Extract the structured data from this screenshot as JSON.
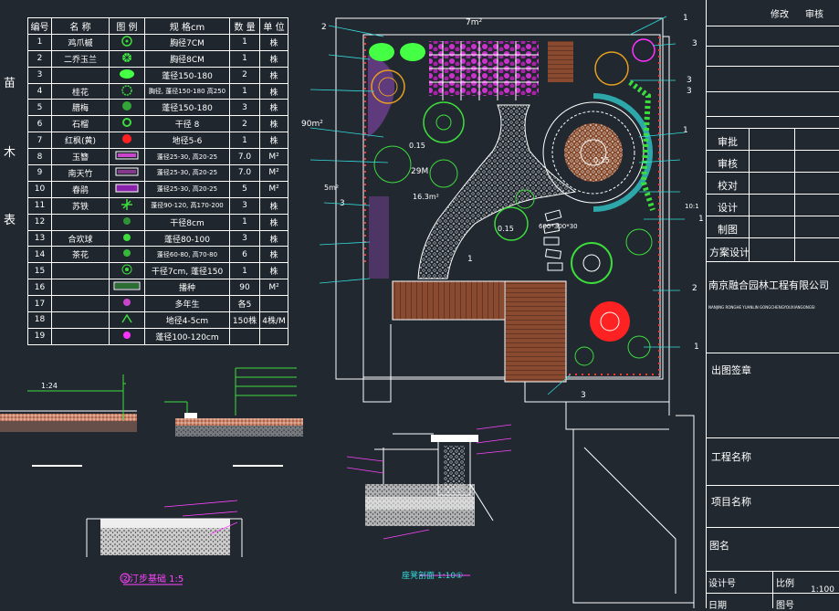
{
  "plant_table": {
    "headers": [
      "编号",
      "名  称",
      "图  例",
      "规  格cm",
      "数 量",
      "单 位"
    ],
    "rows": [
      {
        "no": "1",
        "name": "鸡爪槭",
        "spec": "胸径7CM",
        "qty": "1",
        "unit": "株",
        "icon": "maple",
        "color": "#3ddc3d"
      },
      {
        "no": "2",
        "name": "二乔玉兰",
        "spec": "胸径8CM",
        "qty": "1",
        "unit": "株",
        "icon": "magnolia",
        "color": "#44ff44"
      },
      {
        "no": "3",
        "name": "",
        "spec": "蓬径150-180",
        "qty": "2",
        "unit": "株",
        "icon": "shrub-oval",
        "color": "#44ff44"
      },
      {
        "no": "4",
        "name": "桂花",
        "spec": "胸径, 蓬径150-180 高250",
        "qty": "1",
        "unit": "株",
        "icon": "osmanthus",
        "color": "#3ddc3d"
      },
      {
        "no": "5",
        "name": "腊梅",
        "spec": "蓬径150-180",
        "qty": "3",
        "unit": "株",
        "icon": "wintersweet",
        "color": "#3ddc3d"
      },
      {
        "no": "6",
        "name": "石榴",
        "spec": "干径 8",
        "qty": "2",
        "unit": "株",
        "icon": "pomegranate",
        "color": "#3ddc3d"
      },
      {
        "no": "7",
        "name": "红枫(黄)",
        "spec": "地径5-6",
        "qty": "1",
        "unit": "株",
        "icon": "red-maple",
        "color": "#ff2222"
      },
      {
        "no": "8",
        "name": "玉簪",
        "spec": "蓬径25-30, 高20-25",
        "qty": "7.0",
        "unit": "M²",
        "icon": "hosta",
        "color": "#cc44cc"
      },
      {
        "no": "9",
        "name": "南天竹",
        "spec": "蓬径25-30, 高20-25",
        "qty": "7.0",
        "unit": "M²",
        "icon": "nandina",
        "color": "#cc44cc"
      },
      {
        "no": "10",
        "name": "春鹃",
        "spec": "蓬径25-30, 高20-25",
        "qty": "5",
        "unit": "M²",
        "icon": "azalea",
        "color": "#8822aa"
      },
      {
        "no": "11",
        "name": "苏铁",
        "spec": "蓬径90-120, 高170-200",
        "qty": "3",
        "unit": "株",
        "icon": "cycad",
        "color": "#3ddc3d"
      },
      {
        "no": "12",
        "name": "",
        "spec": "干径8cm",
        "qty": "1",
        "unit": "株",
        "icon": "tree-small",
        "color": "#3ddc3d"
      },
      {
        "no": "13",
        "name": "合欢球",
        "spec": "蓬径80-100",
        "qty": "3",
        "unit": "株",
        "icon": "ball-shrub",
        "color": "#3ddc3d"
      },
      {
        "no": "14",
        "name": "茶花",
        "spec": "蓬径60-80, 高70-80",
        "qty": "6",
        "unit": "株",
        "icon": "camellia",
        "color": "#3ddc3d"
      },
      {
        "no": "15",
        "name": "",
        "spec": "干径7cm, 蓬径150",
        "qty": "1",
        "unit": "株",
        "icon": "tree-medium",
        "color": "#3ddc3d"
      },
      {
        "no": "16",
        "name": "",
        "spec": "播种",
        "qty": "90",
        "unit": "M²",
        "icon": "lawn",
        "color": "#3ddc3d"
      },
      {
        "no": "17",
        "name": "",
        "spec": "多年生",
        "qty": "各5",
        "unit": "",
        "icon": "perennial",
        "color": "#cc44cc"
      },
      {
        "no": "18",
        "name": "",
        "spec": "地径4-5cm",
        "qty": "150株",
        "unit": "4株/M",
        "icon": "bamboo",
        "color": "#3ddc3d"
      },
      {
        "no": "19",
        "name": "",
        "spec": "蓬径100-120cm",
        "qty": "",
        "unit": "",
        "icon": "flower-shrub",
        "color": "#ff33ff"
      }
    ]
  },
  "table_side_title": [
    "苗",
    "木",
    "表"
  ],
  "plan_labels": {
    "lawn_area": "90m²",
    "area_7m": "7m²",
    "path_label": "29M",
    "pond_area": "16.3m²",
    "level_1": "0.15",
    "level_2": "0.15",
    "level_3": "0.15",
    "paving_note": "600*300*30",
    "area_5m": "5m²",
    "ratio_1": "10:1",
    "label_2": "2",
    "label_3a": "3",
    "label_3b": "3",
    "label_3c": "3",
    "label_3d": "3",
    "label_1a": "1",
    "label_1b": "1",
    "label_1c": "1",
    "label_1d": "1",
    "label_1e": "1",
    "label_2b": "2",
    "label_3e": "3"
  },
  "details": {
    "detail1_scale": "1:24",
    "detail3_title": "②汀步基础 1:5",
    "detail4_title": "座凳剖面 1:10①"
  },
  "title_block": {
    "revise": "修改",
    "review_head": "审核",
    "approve": "审批",
    "check": "审核",
    "proofread": "校对",
    "design": "设计",
    "draft": "制图",
    "scheme": "方案设计",
    "company": "南京融合园林工程有限公司",
    "company_pinyin": "NANJING RONGHE YUANLIN GONGCHENGYOUXIANGONGSI",
    "issue_sign": "出图签章",
    "project_name": "工程名称",
    "item_name": "项目名称",
    "drawing_name": "图名",
    "design_no": "设计号",
    "scale_label": "比例",
    "scale_value": "1:100",
    "date_label": "日期",
    "drawing_no": "图号"
  },
  "colors": {
    "background": "#212830",
    "line": "#ffffff",
    "plant_green": "#3ddc3d",
    "pergola_purple": "#cc33cc",
    "paving_orange": "#c0704a",
    "water_cyan": "#33dddd",
    "flower_red": "#ff2222"
  }
}
